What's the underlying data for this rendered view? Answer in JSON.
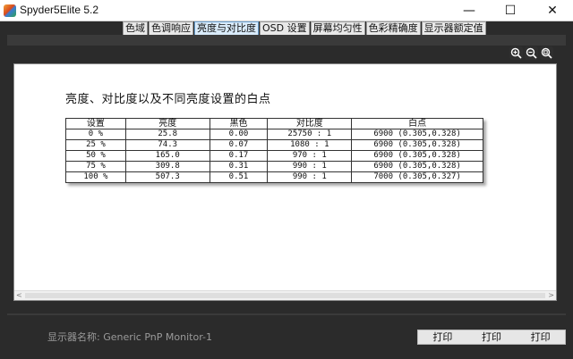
{
  "window": {
    "title": "Spyder5Elite 5.2",
    "minimize": "—",
    "maximize": "☐",
    "close": "✕"
  },
  "tabs": [
    {
      "label": "色域",
      "active": false
    },
    {
      "label": "色调响应",
      "active": false
    },
    {
      "label": "亮度与对比度",
      "active": true
    },
    {
      "label": "OSD 设置",
      "active": false
    },
    {
      "label": "屏幕均匀性",
      "active": false
    },
    {
      "label": "色彩精确度",
      "active": false
    },
    {
      "label": "显示器额定值",
      "active": false
    }
  ],
  "toolbar": {
    "icons": [
      "zoom-in-icon",
      "zoom-out-icon",
      "zoom-fit-icon"
    ]
  },
  "report": {
    "heading": "亮度、对比度以及不同亮度设置的白点",
    "columns": [
      "设置",
      "亮度",
      "黑色",
      "对比度",
      "白点"
    ],
    "rows": [
      [
        "0 %",
        "25.8",
        "0.00",
        "25750 : 1",
        "6900 (0.305,0.328)"
      ],
      [
        "25 %",
        "74.3",
        "0.07",
        "1080 : 1",
        "6900 (0.305,0.328)"
      ],
      [
        "50 %",
        "165.0",
        "0.17",
        "970 : 1",
        "6900 (0.305,0.328)"
      ],
      [
        "75 %",
        "309.8",
        "0.31",
        "990 : 1",
        "6900 (0.305,0.328)"
      ],
      [
        "100 %",
        "507.3",
        "0.51",
        "990 : 1",
        "7000 (0.305,0.327)"
      ]
    ]
  },
  "scrollbar": {
    "left": "<",
    "right": ">"
  },
  "footer": {
    "monitor_label": "显示器名称: Generic PnP Monitor-1",
    "print_buttons": [
      "打印",
      "打印",
      "打印"
    ]
  },
  "colors": {
    "background": "#2b2b2b",
    "active_tab": "#d9ebfa",
    "content_bg": "#ffffff"
  }
}
